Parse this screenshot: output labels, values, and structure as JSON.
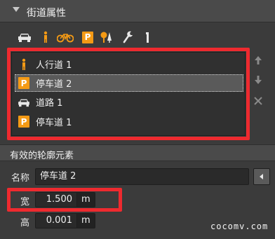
{
  "panel": {
    "title": "街道属性"
  },
  "toolbar": {
    "icons": [
      "car-icon",
      "pedestrian-icon",
      "bicycle-icon",
      "parking-icon",
      "tree-icon",
      "wrench-icon",
      "pole-icon"
    ],
    "parking_glyph": "P"
  },
  "profile_list": {
    "items": [
      {
        "label": "人行道 1",
        "icon": "pedestrian-icon",
        "selected": false
      },
      {
        "label": "停车道 2",
        "icon": "parking-icon",
        "selected": true
      },
      {
        "label": "道路 1",
        "icon": "car-icon",
        "selected": false
      },
      {
        "label": "停车道 1",
        "icon": "parking-icon",
        "selected": false
      }
    ]
  },
  "side_buttons": [
    "move-up-icon",
    "move-down-icon",
    "delete-icon"
  ],
  "section": {
    "title": "有效的轮廓元素"
  },
  "fields": {
    "name_label": "名称",
    "name_value": "停车道 2",
    "width_label": "宽",
    "width_value": "1.500",
    "width_unit": "m",
    "height_label": "高",
    "height_value": "0.001",
    "height_unit": "m"
  },
  "watermark": "cocomv.com",
  "colors": {
    "highlight": "#ee2a2f",
    "accent_orange": "#f49a15",
    "background": "#3b3b3b"
  }
}
